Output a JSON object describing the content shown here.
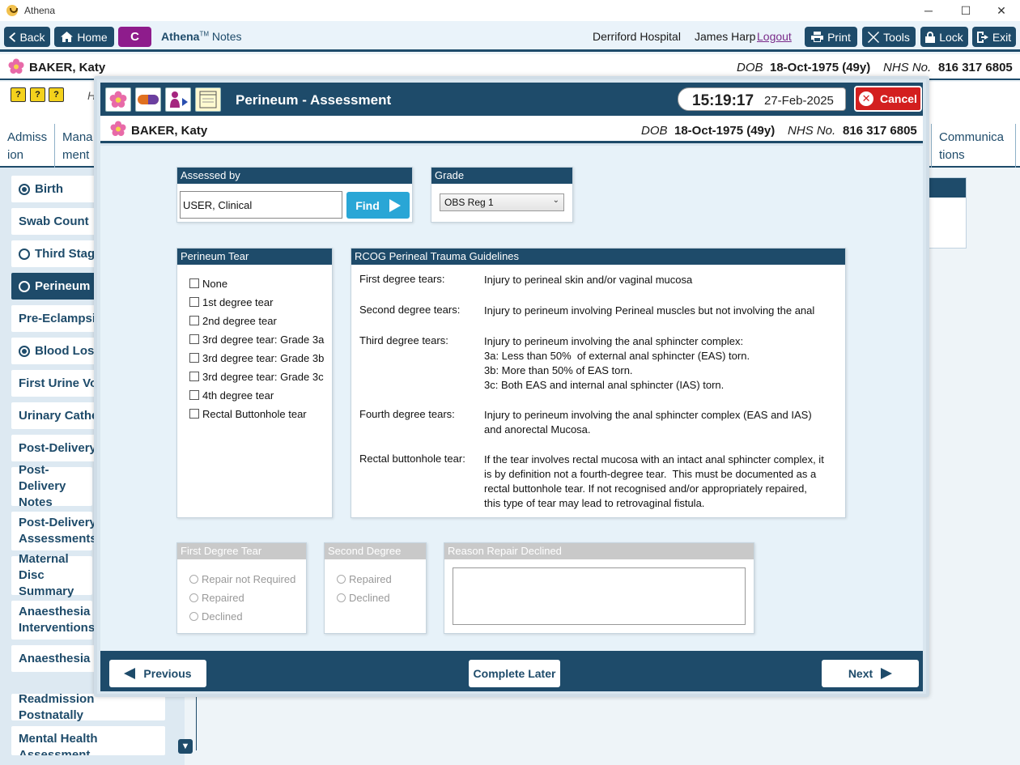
{
  "window": {
    "title": "Athena",
    "controls": [
      "─",
      "☐",
      "✕"
    ]
  },
  "toolbar": {
    "back": "Back",
    "home": "Home",
    "c_button": "C",
    "brand": "Athena",
    "tm": "TM",
    "notes": "Notes",
    "hospital": "Derriford Hospital",
    "user": "James Harp",
    "logout": "Logout",
    "print": "Print",
    "tools": "Tools",
    "lock": "Lock",
    "exit": "Exit"
  },
  "patient": {
    "name": "BAKER, Katy",
    "dob_label": "DOB",
    "dob": "18-Oct-1975 (49y)",
    "nhs_label": "NHS No.",
    "nhs": "816 317 6805"
  },
  "background": {
    "sub_icons": [
      "?",
      "?",
      "?"
    ],
    "h_letter": "H",
    "tabs": [
      {
        "label": "Admiss\nion"
      },
      {
        "label": "Mana\nment"
      },
      {
        "label": "Communica\ntions"
      }
    ],
    "nav": [
      {
        "label": "Birth",
        "radio": "filled"
      },
      {
        "label": "Swab Count",
        "radio": "none"
      },
      {
        "label": "Third Stage",
        "radio": "empty"
      },
      {
        "label": "Perineum",
        "radio": "empty",
        "active": true
      },
      {
        "label": "Pre-Eclampsia",
        "radio": "none"
      },
      {
        "label": "Blood Loss",
        "radio": "filled"
      },
      {
        "label": "First Urine Voi",
        "radio": "none"
      },
      {
        "label": "Urinary Cathe",
        "radio": "none"
      },
      {
        "label": "Post-Delivery",
        "radio": "none"
      },
      {
        "label": "Post-Delivery Notes",
        "radio": "none"
      },
      {
        "label": "Post-Delivery Assessments",
        "radio": "none"
      },
      {
        "label": "Maternal Disc Summary",
        "radio": "none"
      },
      {
        "label": "Anaesthesia Interventions",
        "radio": "none"
      },
      {
        "label": "Anaesthesia F",
        "radio": "none"
      },
      {
        "label": "Readmission Postnatally",
        "radio": "none"
      },
      {
        "label": "Mental Health Assessment",
        "radio": "none"
      }
    ]
  },
  "modal": {
    "title": "Perineum - Assessment",
    "time": "15:19:17",
    "date": "27-Feb-2025",
    "cancel": "Cancel",
    "assessed_by": {
      "title": "Assessed by",
      "value": "USER, Clinical",
      "find": "Find"
    },
    "grade": {
      "title": "Grade",
      "selected": "OBS Reg 1"
    },
    "perineum_tear": {
      "title": "Perineum Tear",
      "options": [
        "None",
        "1st degree tear",
        "2nd degree tear",
        "3rd degree tear: Grade 3a",
        "3rd degree tear: Grade 3b",
        "3rd degree tear: Grade 3c",
        "4th degree tear",
        "Rectal Buttonhole tear"
      ]
    },
    "guidelines": {
      "title": "RCOG Perineal Trauma Guidelines",
      "rows": [
        {
          "label": "First degree tears:",
          "text": [
            "Injury to perineal skin and/or vaginal mucosa"
          ]
        },
        {
          "label": "Second degree tears:",
          "text": [
            "Injury to perineum involving Perineal muscles but not involving the anal"
          ]
        },
        {
          "label": "Third degree tears:",
          "text": [
            "Injury to perineum involving the anal sphincter complex:",
            "3a: Less than 50%  of external anal sphincter (EAS) torn.",
            "3b: More than 50% of EAS torn.",
            "3c: Both EAS and internal anal sphincter (IAS) torn."
          ]
        },
        {
          "label": "Fourth degree tears:",
          "text": [
            "Injury to perineum involving the anal sphincter complex (EAS and IAS)",
            "and anorectal Mucosa."
          ]
        },
        {
          "label": "Rectal buttonhole tear:",
          "text": [
            "If the tear involves rectal mucosa with an intact anal sphincter complex, it",
            "is by definition not a fourth-degree tear.  This must be documented as a",
            "rectal buttonhole tear. If not recognised and/or appropriately repaired,",
            "this type of tear may lead to retrovaginal fistula."
          ]
        }
      ]
    },
    "first_degree": {
      "title": "First Degree Tear",
      "options": [
        "Repair not Required",
        "Repaired",
        "Declined"
      ]
    },
    "second_degree": {
      "title": "Second Degree Tear",
      "options": [
        "Repaired",
        "Declined"
      ]
    },
    "reason_declined": {
      "title": "Reason Repair Declined",
      "value": ""
    },
    "footer": {
      "previous": "Previous",
      "complete_later": "Complete Later",
      "next": "Next"
    }
  },
  "colors": {
    "primary": "#1e4b6a",
    "accent_c": "#8e1c8c",
    "find": "#29a6d6",
    "cancel": "#d31f1f"
  }
}
